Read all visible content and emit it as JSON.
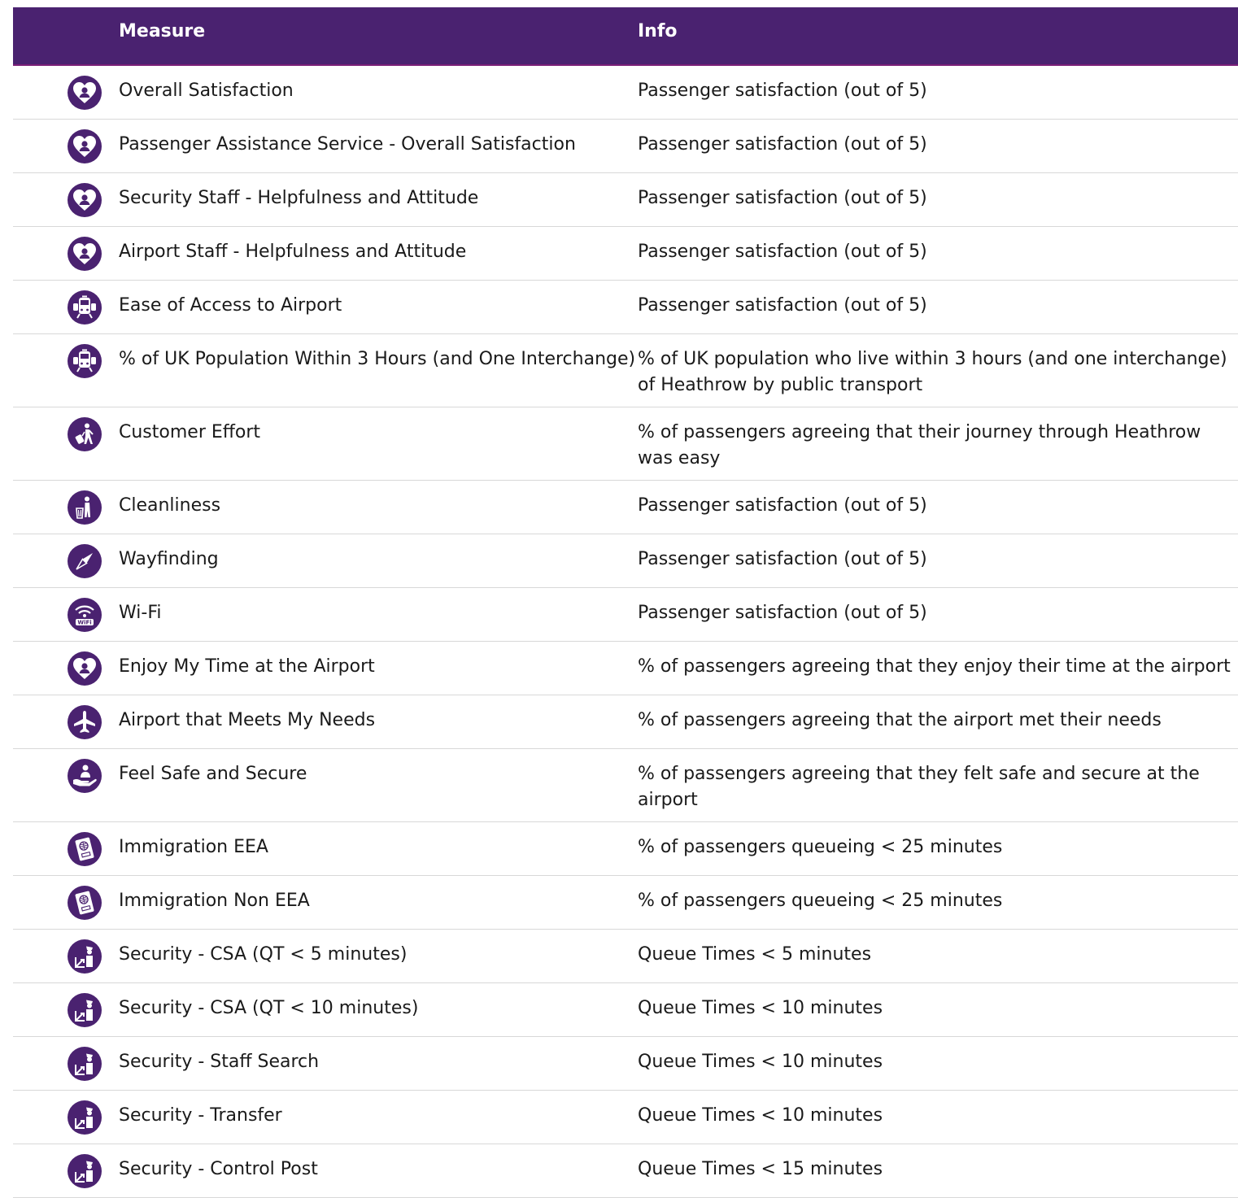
{
  "table": {
    "headers": {
      "measure": "Measure",
      "info": "Info"
    },
    "colors": {
      "header_bg": "#4a2270",
      "icon_bg": "#4a2270",
      "divider": "#d8d8d8"
    },
    "rows": [
      {
        "icon": "heart-person-icon",
        "measure": "Overall Satisfaction",
        "info": "Passenger satisfaction (out of 5)"
      },
      {
        "icon": "heart-person-icon",
        "measure": "Passenger Assistance Service - Overall Satisfaction",
        "info": "Passenger satisfaction (out of 5)"
      },
      {
        "icon": "heart-person-icon",
        "measure": "Security Staff - Helpfulness and Attitude",
        "info": "Passenger satisfaction (out of 5)"
      },
      {
        "icon": "heart-person-icon",
        "measure": "Airport Staff - Helpfulness and Attitude",
        "info": "Passenger satisfaction (out of 5)"
      },
      {
        "icon": "train-icon",
        "measure": "Ease of Access to Airport",
        "info": "Passenger satisfaction (out of 5)"
      },
      {
        "icon": "train-icon",
        "measure": "% of UK Population Within 3 Hours (and One Interchange)",
        "info": "% of UK population who live within 3 hours (and one interchange) of Heathrow by public transport"
      },
      {
        "icon": "traveller-luggage-icon",
        "measure": "Customer Effort",
        "info": "% of passengers agreeing that their journey through Heathrow was easy"
      },
      {
        "icon": "cleaner-bin-icon",
        "measure": "Cleanliness",
        "info": "Passenger satisfaction (out of 5)"
      },
      {
        "icon": "compass-icon",
        "measure": "Wayfinding",
        "info": "Passenger satisfaction (out of 5)"
      },
      {
        "icon": "wifi-icon",
        "measure": "Wi-Fi",
        "info": "Passenger satisfaction (out of 5)"
      },
      {
        "icon": "heart-person-icon",
        "measure": "Enjoy My Time at the Airport",
        "info": "% of passengers agreeing that they enjoy their time at the airport"
      },
      {
        "icon": "airplane-icon",
        "measure": "Airport that Meets My Needs",
        "info": "% of passengers agreeing that the airport met their needs"
      },
      {
        "icon": "hand-person-icon",
        "measure": "Feel Safe and Secure",
        "info": "% of passengers agreeing that they felt safe and secure at the airport"
      },
      {
        "icon": "passport-icon",
        "measure": "Immigration EEA",
        "info": "% of passengers queueing < 25 minutes"
      },
      {
        "icon": "passport-icon",
        "measure": "Immigration Non EEA",
        "info": "% of passengers queueing < 25 minutes"
      },
      {
        "icon": "security-officer-icon",
        "measure": "Security - CSA (QT < 5 minutes)",
        "info": "Queue Times < 5 minutes"
      },
      {
        "icon": "security-officer-icon",
        "measure": "Security - CSA (QT < 10 minutes)",
        "info": "Queue Times < 10 minutes"
      },
      {
        "icon": "security-officer-icon",
        "measure": "Security - Staff Search",
        "info": "Queue Times < 10 minutes"
      },
      {
        "icon": "security-officer-icon",
        "measure": "Security - Transfer",
        "info": "Queue Times < 10 minutes"
      },
      {
        "icon": "security-officer-icon",
        "measure": "Security - Control Post",
        "info": "Queue Times < 15 minutes"
      }
    ]
  }
}
